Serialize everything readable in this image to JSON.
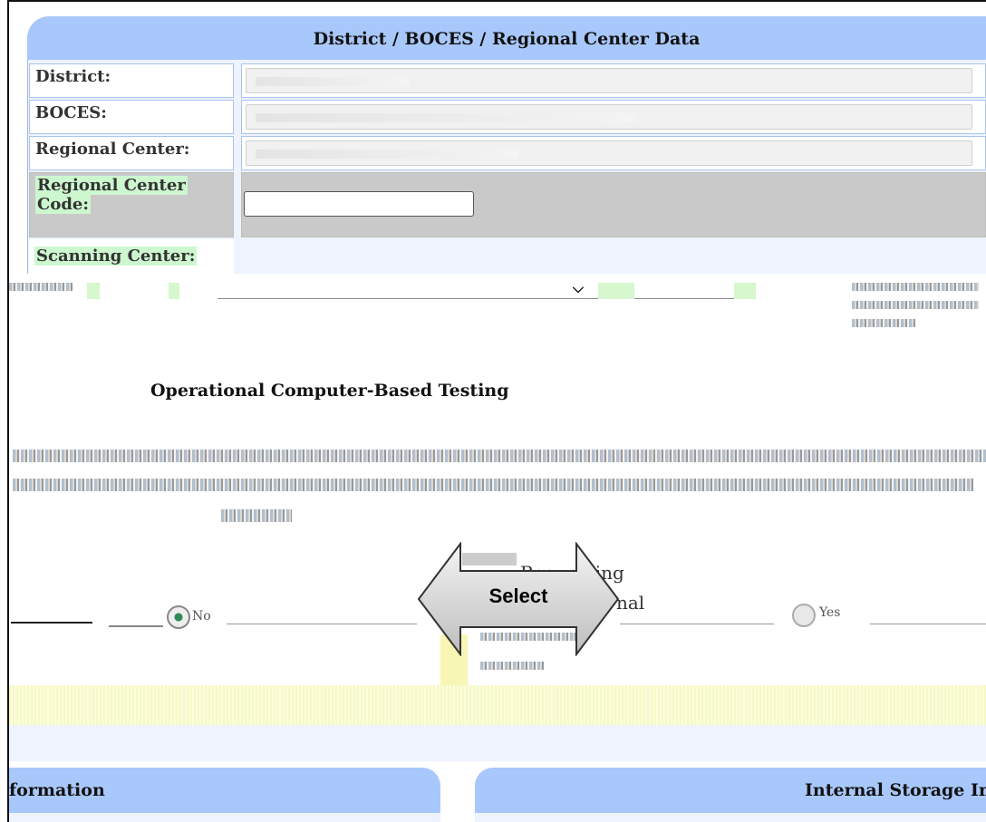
{
  "panel": {
    "title": "District / BOCES / Regional Center Data"
  },
  "fields": {
    "district_label": "District:",
    "boces_label": "BOCES:",
    "regional_center_label": "Regional Center:",
    "regional_center_code_label_1": "Regional Center",
    "regional_center_code_label_2": "Code:",
    "regional_center_code_value": "",
    "scanning_center_label": "Scanning Center:"
  },
  "cbt": {
    "title": "Operational Computer-Based Testing",
    "requesting_1": "Requesting",
    "requesting_2": "nal"
  },
  "radios": {
    "no_label": "No",
    "yes_label": "Yes"
  },
  "overlay": {
    "select_label": "Select"
  },
  "bottom": {
    "left_title": "formation",
    "right_title": "Internal Storage In"
  },
  "colors": {
    "header_blue": "#a8c8fb",
    "panel_bg": "#eef3fd",
    "highlight_green": "#cdf7cf"
  }
}
